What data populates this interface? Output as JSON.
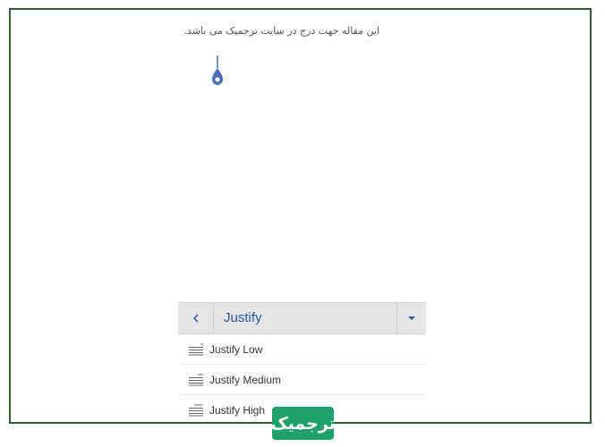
{
  "document": {
    "body_text": "این مقاله جهت درج در سایت ترجمیک می باشد."
  },
  "panel": {
    "title": "Justify",
    "items": [
      {
        "label": "Justify Low"
      },
      {
        "label": "Justify Medium"
      },
      {
        "label": "Justify High"
      }
    ]
  },
  "colors": {
    "frame_border": "#2e5e35",
    "accent": "#2b579a",
    "handle": "#4a6fb5",
    "logo_bg": "#21a16a"
  },
  "icons": {
    "back": "chevron-left-icon",
    "dropdown": "caret-down-icon",
    "justify": "justify-lines-icon",
    "handle": "text-cursor-handle-icon"
  },
  "watermark": {
    "text": "ترجمیک"
  }
}
